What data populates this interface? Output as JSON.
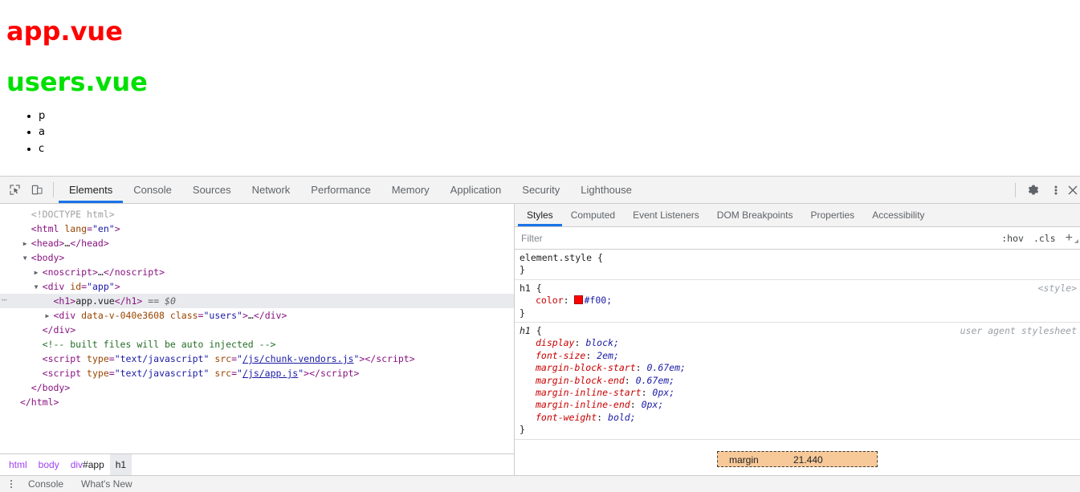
{
  "page": {
    "headings": [
      {
        "text": "app.vue",
        "color": "#ff0000"
      },
      {
        "text": "users.vue",
        "color": "#00e000"
      }
    ],
    "list_items": [
      "p",
      "a",
      "c"
    ]
  },
  "devtools": {
    "toolbar": {
      "inspect_icon": "inspect-element-icon",
      "device_icon": "device-toolbar-icon",
      "tabs": [
        {
          "label": "Elements",
          "active": true
        },
        {
          "label": "Console",
          "active": false
        },
        {
          "label": "Sources",
          "active": false
        },
        {
          "label": "Network",
          "active": false
        },
        {
          "label": "Performance",
          "active": false
        },
        {
          "label": "Memory",
          "active": false
        },
        {
          "label": "Application",
          "active": false
        },
        {
          "label": "Security",
          "active": false
        },
        {
          "label": "Lighthouse",
          "active": false
        }
      ],
      "settings_icon": "gear-icon",
      "more_icon": "more-vertical-icon",
      "close_icon": "close-icon"
    },
    "dom_tree": [
      {
        "indent": 0,
        "twisty": "",
        "selected": false,
        "parts": [
          {
            "t": "doctype",
            "v": "<!DOCTYPE html>"
          }
        ]
      },
      {
        "indent": 0,
        "twisty": "",
        "selected": false,
        "parts": [
          {
            "t": "punct",
            "v": "<"
          },
          {
            "t": "tag",
            "v": "html"
          },
          {
            "t": "sp",
            "v": " "
          },
          {
            "t": "attr",
            "v": "lang"
          },
          {
            "t": "punct",
            "v": "="
          },
          {
            "t": "val",
            "v": "\"en\""
          },
          {
            "t": "punct",
            "v": ">"
          }
        ]
      },
      {
        "indent": 0,
        "twisty": "right",
        "selected": false,
        "parts": [
          {
            "t": "punct",
            "v": "<"
          },
          {
            "t": "tag",
            "v": "head"
          },
          {
            "t": "punct",
            "v": ">"
          },
          {
            "t": "text",
            "v": "…"
          },
          {
            "t": "punct",
            "v": "</"
          },
          {
            "t": "tag",
            "v": "head"
          },
          {
            "t": "punct",
            "v": ">"
          }
        ]
      },
      {
        "indent": 0,
        "twisty": "down",
        "selected": false,
        "parts": [
          {
            "t": "punct",
            "v": "<"
          },
          {
            "t": "tag",
            "v": "body"
          },
          {
            "t": "punct",
            "v": ">"
          }
        ]
      },
      {
        "indent": 1,
        "twisty": "right",
        "selected": false,
        "parts": [
          {
            "t": "punct",
            "v": "<"
          },
          {
            "t": "tag",
            "v": "noscript"
          },
          {
            "t": "punct",
            "v": ">"
          },
          {
            "t": "text",
            "v": "…"
          },
          {
            "t": "punct",
            "v": "</"
          },
          {
            "t": "tag",
            "v": "noscript"
          },
          {
            "t": "punct",
            "v": ">"
          }
        ]
      },
      {
        "indent": 1,
        "twisty": "down",
        "selected": false,
        "parts": [
          {
            "t": "punct",
            "v": "<"
          },
          {
            "t": "tag",
            "v": "div"
          },
          {
            "t": "sp",
            "v": " "
          },
          {
            "t": "attr",
            "v": "id"
          },
          {
            "t": "punct",
            "v": "="
          },
          {
            "t": "val",
            "v": "\"app\""
          },
          {
            "t": "punct",
            "v": ">"
          }
        ]
      },
      {
        "indent": 2,
        "twisty": "",
        "selected": true,
        "dots": true,
        "parts": [
          {
            "t": "punct",
            "v": "<"
          },
          {
            "t": "tag",
            "v": "h1"
          },
          {
            "t": "punct",
            "v": ">"
          },
          {
            "t": "text",
            "v": "app.vue"
          },
          {
            "t": "punct",
            "v": "</"
          },
          {
            "t": "tag",
            "v": "h1"
          },
          {
            "t": "punct",
            "v": ">"
          },
          {
            "t": "sp",
            "v": " "
          },
          {
            "t": "dollar",
            "v": "== $0"
          }
        ]
      },
      {
        "indent": 2,
        "twisty": "right",
        "selected": false,
        "parts": [
          {
            "t": "punct",
            "v": "<"
          },
          {
            "t": "tag",
            "v": "div"
          },
          {
            "t": "sp",
            "v": " "
          },
          {
            "t": "attr",
            "v": "data-v-040e3608"
          },
          {
            "t": "sp",
            "v": " "
          },
          {
            "t": "attr",
            "v": "class"
          },
          {
            "t": "punct",
            "v": "="
          },
          {
            "t": "val",
            "v": "\"users\""
          },
          {
            "t": "punct",
            "v": ">"
          },
          {
            "t": "text",
            "v": "…"
          },
          {
            "t": "punct",
            "v": "</"
          },
          {
            "t": "tag",
            "v": "div"
          },
          {
            "t": "punct",
            "v": ">"
          }
        ]
      },
      {
        "indent": 1,
        "twisty": "",
        "selected": false,
        "parts": [
          {
            "t": "punct",
            "v": "</"
          },
          {
            "t": "tag",
            "v": "div"
          },
          {
            "t": "punct",
            "v": ">"
          }
        ]
      },
      {
        "indent": 1,
        "twisty": "",
        "selected": false,
        "parts": [
          {
            "t": "comment",
            "v": "<!-- built files will be auto injected -->"
          }
        ]
      },
      {
        "indent": 1,
        "twisty": "",
        "selected": false,
        "parts": [
          {
            "t": "punct",
            "v": "<"
          },
          {
            "t": "tag",
            "v": "script"
          },
          {
            "t": "sp",
            "v": " "
          },
          {
            "t": "attr",
            "v": "type"
          },
          {
            "t": "punct",
            "v": "="
          },
          {
            "t": "val",
            "v": "\"text/javascript\""
          },
          {
            "t": "sp",
            "v": " "
          },
          {
            "t": "attr",
            "v": "src"
          },
          {
            "t": "punct",
            "v": "="
          },
          {
            "t": "val",
            "v": "\""
          },
          {
            "t": "link",
            "v": "/js/chunk-vendors.js"
          },
          {
            "t": "val",
            "v": "\""
          },
          {
            "t": "punct",
            "v": "></"
          },
          {
            "t": "tag",
            "v": "script"
          },
          {
            "t": "punct",
            "v": ">"
          }
        ]
      },
      {
        "indent": 1,
        "twisty": "",
        "selected": false,
        "parts": [
          {
            "t": "punct",
            "v": "<"
          },
          {
            "t": "tag",
            "v": "script"
          },
          {
            "t": "sp",
            "v": " "
          },
          {
            "t": "attr",
            "v": "type"
          },
          {
            "t": "punct",
            "v": "="
          },
          {
            "t": "val",
            "v": "\"text/javascript\""
          },
          {
            "t": "sp",
            "v": " "
          },
          {
            "t": "attr",
            "v": "src"
          },
          {
            "t": "punct",
            "v": "="
          },
          {
            "t": "val",
            "v": "\""
          },
          {
            "t": "link",
            "v": "/js/app.js"
          },
          {
            "t": "val",
            "v": "\""
          },
          {
            "t": "punct",
            "v": "></"
          },
          {
            "t": "tag",
            "v": "script"
          },
          {
            "t": "punct",
            "v": ">"
          }
        ]
      },
      {
        "indent": 0,
        "twisty": "",
        "selected": false,
        "parts": [
          {
            "t": "punct",
            "v": "</"
          },
          {
            "t": "tag",
            "v": "body"
          },
          {
            "t": "punct",
            "v": ">"
          }
        ]
      },
      {
        "indent": -1,
        "twisty": "",
        "selected": false,
        "parts": [
          {
            "t": "punct",
            "v": "</"
          },
          {
            "t": "tag",
            "v": "html"
          },
          {
            "t": "punct",
            "v": ">"
          }
        ]
      }
    ],
    "breadcrumb": [
      {
        "tag": "html",
        "id": "",
        "selected": false
      },
      {
        "tag": "body",
        "id": "",
        "selected": false
      },
      {
        "tag": "div",
        "id": "#app",
        "selected": false
      },
      {
        "tag": "h1",
        "id": "",
        "selected": true
      }
    ],
    "styles": {
      "tabs": [
        {
          "label": "Styles",
          "active": true
        },
        {
          "label": "Computed",
          "active": false
        },
        {
          "label": "Event Listeners",
          "active": false
        },
        {
          "label": "DOM Breakpoints",
          "active": false
        },
        {
          "label": "Properties",
          "active": false
        },
        {
          "label": "Accessibility",
          "active": false
        }
      ],
      "filter_placeholder": "Filter",
      "filter_value": "",
      "hov_label": ":hov",
      "cls_label": ".cls",
      "plus_label": "+",
      "rules": [
        {
          "selector": "element.style",
          "origin": "",
          "user_agent": false,
          "declarations": []
        },
        {
          "selector": "h1",
          "origin": "<style>",
          "user_agent": false,
          "declarations": [
            {
              "prop": "color",
              "value": "#f00",
              "swatch": "#ff0000"
            }
          ]
        },
        {
          "selector": "h1",
          "origin": "user agent stylesheet",
          "user_agent": true,
          "declarations": [
            {
              "prop": "display",
              "value": "block",
              "swatch": ""
            },
            {
              "prop": "font-size",
              "value": "2em",
              "swatch": ""
            },
            {
              "prop": "margin-block-start",
              "value": "0.67em",
              "swatch": ""
            },
            {
              "prop": "margin-block-end",
              "value": "0.67em",
              "swatch": ""
            },
            {
              "prop": "margin-inline-start",
              "value": "0px",
              "swatch": ""
            },
            {
              "prop": "margin-inline-end",
              "value": "0px",
              "swatch": ""
            },
            {
              "prop": "font-weight",
              "value": "bold",
              "swatch": ""
            }
          ]
        }
      ],
      "box_model": {
        "label": "margin",
        "value": "21.440",
        "color": "#f7c999"
      }
    },
    "drawer": {
      "menu_icon": "more-vertical-icon",
      "tabs": [
        {
          "label": "Console"
        },
        {
          "label": "What's New"
        }
      ]
    }
  }
}
